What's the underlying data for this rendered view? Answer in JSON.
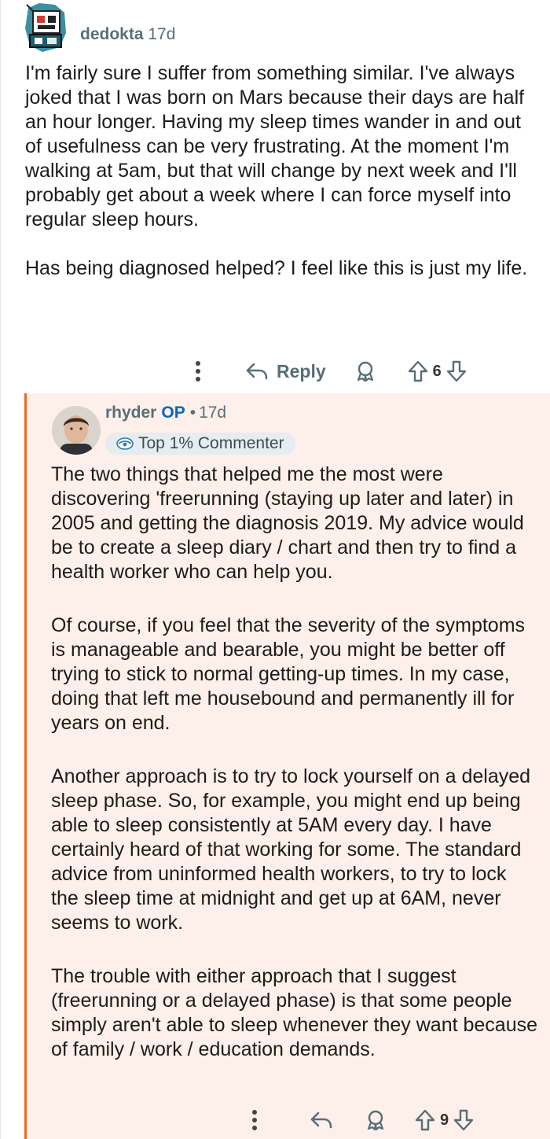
{
  "comment": {
    "author": "dedokta",
    "age": "17d",
    "paragraphs": [
      "I'm fairly sure I suffer from something similar. I've always joked that I was born on Mars because their days are half an hour longer. Having my sleep times wander in and out of usefulness can be very frustrating. At the moment I'm walking at 5am, but that will change by next week and I'll probably get about a week where I can force myself into regular sleep hours.",
      "Has being diagnosed helped? I feel like this is just my life."
    ],
    "actions": {
      "more_icon": "more-dots-icon",
      "reply_label": "Reply",
      "award_icon": "award-icon",
      "vote_count": "6"
    }
  },
  "reply": {
    "author": "rhyder",
    "op_label": "OP",
    "age": "17d",
    "badge": "Top 1% Commenter",
    "paragraphs": [
      "The two things that helped me the most were discovering 'freerunning (staying up later and later) in 2005 and getting the diagnosis 2019. My advice would be to create a sleep diary / chart and then try to find a health worker who can help you.",
      "Of course, if you feel that the severity of the symptoms is manageable and bearable, you might be better off trying to stick to normal getting-up times. In my case, doing that left me housebound and permanently ill for years on end.",
      "Another approach is to try to lock yourself on a delayed sleep phase. So, for example, you might end up being able to sleep consistently at 5AM every day. I have certainly heard of that working for some. The standard advice from uninformed health workers, to try to lock the sleep time at midnight and get up at 6AM, never seems to work.",
      "The trouble with either approach that I suggest (freerunning or a delayed phase) is that some people simply aren't able to sleep whenever they want because of family / work / education demands."
    ],
    "actions": {
      "vote_count": "9"
    }
  },
  "colors": {
    "thread_line": "#f26522",
    "highlight_bg": "#fdefe9",
    "op": "#0a66c2"
  }
}
